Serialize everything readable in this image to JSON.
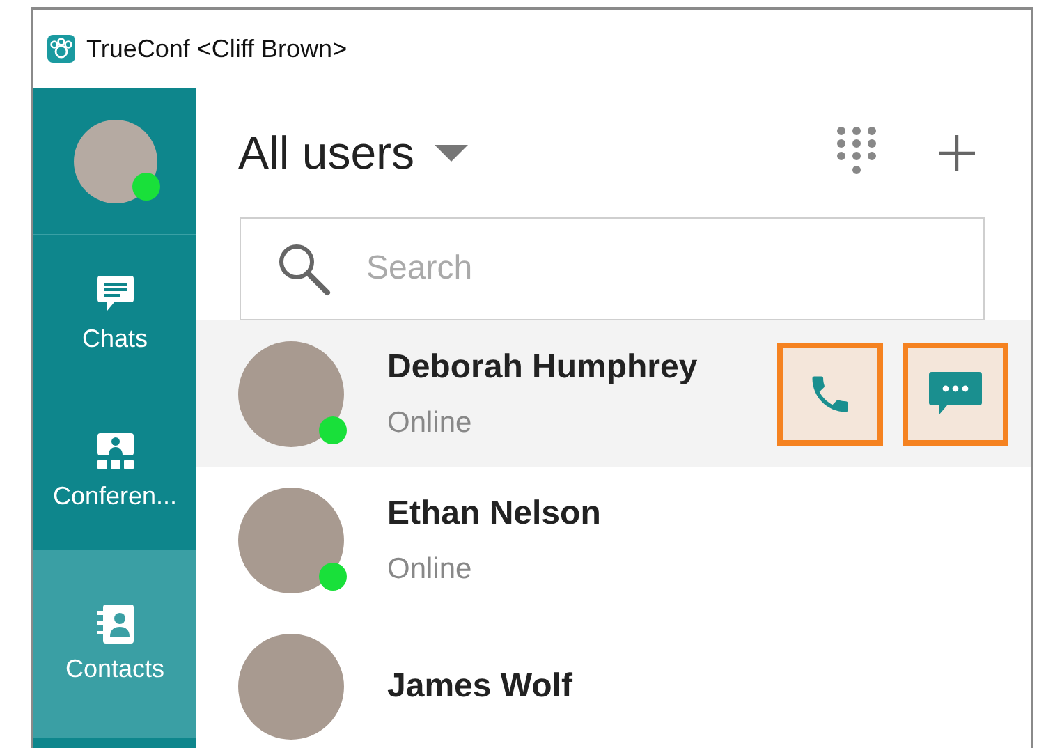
{
  "window": {
    "title": "TrueConf <Cliff Brown>"
  },
  "profile": {
    "online": true
  },
  "sidebar": {
    "items": [
      {
        "kind": "chats",
        "label": "Chats",
        "selected": false
      },
      {
        "kind": "conferences",
        "label": "Conferen...",
        "selected": false
      },
      {
        "kind": "contacts",
        "label": "Contacts",
        "selected": true
      }
    ]
  },
  "header": {
    "title": "All users"
  },
  "search": {
    "placeholder": "Search"
  },
  "contacts": [
    {
      "name": "Deborah Humphrey",
      "status": "Online",
      "online": true,
      "selected": true,
      "actions": [
        {
          "kind": "call",
          "highlighted": true
        },
        {
          "kind": "message",
          "highlighted": true
        }
      ]
    },
    {
      "name": "Ethan Nelson",
      "status": "Online",
      "online": true,
      "selected": false
    },
    {
      "name": "James Wolf",
      "online": false,
      "selected": false
    }
  ]
}
